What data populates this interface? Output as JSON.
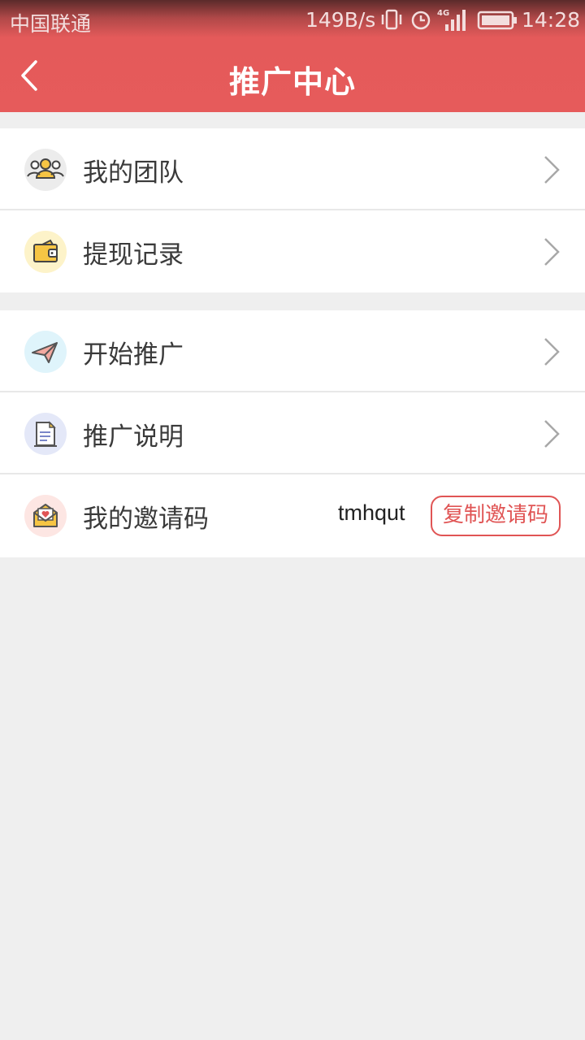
{
  "statusbar": {
    "carrier": "中国联通",
    "net_speed": "149B/s",
    "network_type": "4G",
    "time": "14:28",
    "icons": [
      "vibrate-icon",
      "alarm-icon",
      "signal-icon",
      "battery-icon"
    ]
  },
  "navbar": {
    "back_icon": "chevron-left-icon",
    "title": "推广中心"
  },
  "groups": [
    {
      "items": [
        {
          "label": "我的团队",
          "icon": "team-icon"
        },
        {
          "label": "提现记录",
          "icon": "wallet-icon"
        }
      ]
    },
    {
      "items": [
        {
          "label": "开始推广",
          "icon": "paper-plane-icon"
        },
        {
          "label": "推广说明",
          "icon": "document-icon"
        },
        {
          "label": "我的邀请码",
          "icon": "envelope-heart-icon",
          "value": "tmhqut",
          "action_label": "复制邀请码"
        }
      ]
    }
  ],
  "colors": {
    "accent": "#e65b5b",
    "background": "#efefef",
    "row_background": "#ffffff"
  }
}
